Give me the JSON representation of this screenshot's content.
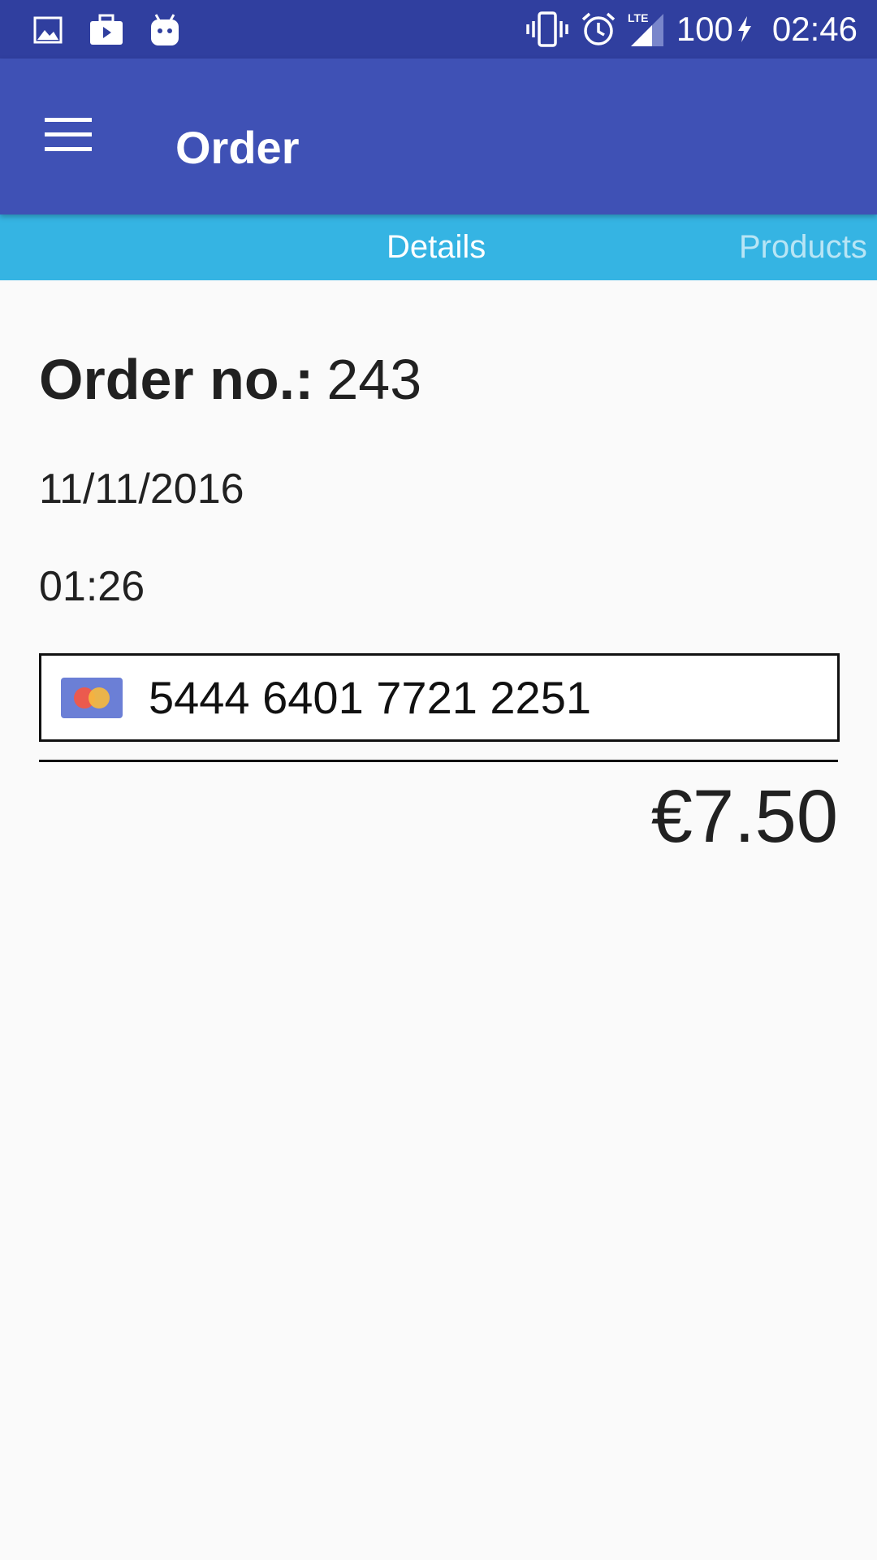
{
  "status_bar": {
    "left_icons": [
      "gallery-icon",
      "briefcase-play-icon",
      "android-icon"
    ],
    "right_icons": [
      "vibrate-icon",
      "alarm-icon",
      "lte-signal-icon"
    ],
    "battery": "100",
    "time": "02:46"
  },
  "app_bar": {
    "title": "Order",
    "menu_icon": "menu-icon",
    "color": "#3f51b5"
  },
  "tabs": [
    {
      "label": "Details",
      "selected": true
    },
    {
      "label": "Products",
      "selected": false
    }
  ],
  "order": {
    "label": "Order no.:",
    "number": "243",
    "date": "11/11/2016",
    "time": "01:26",
    "card_number": "5444 6401 7721 2251",
    "card_icon": "mastercard-icon",
    "total": "€7.50"
  },
  "colors": {
    "status_bar": "#303f9f",
    "tab_bar": "#35b4e3",
    "background": "#fafafa"
  }
}
